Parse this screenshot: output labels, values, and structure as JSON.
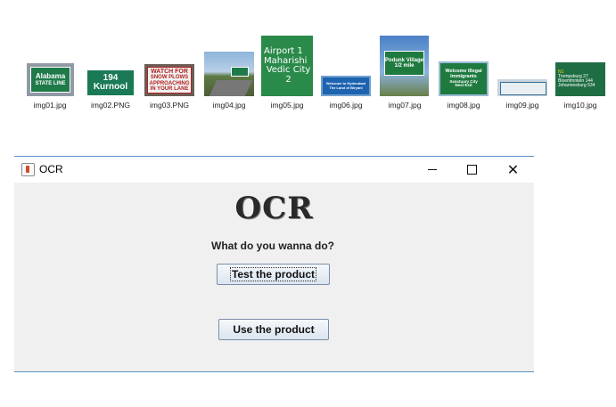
{
  "explorer": {
    "files": [
      {
        "name": "img01.jpg",
        "sign": [
          "Alabama",
          "STATE LINE"
        ]
      },
      {
        "name": "img02.PNG",
        "sign": [
          "194",
          "Kurnool"
        ]
      },
      {
        "name": "img03.PNG",
        "sign": [
          "WATCH FOR",
          "SNOW PLOWS",
          "APPROACHING",
          "IN YOUR LANE"
        ]
      },
      {
        "name": "img04.jpg",
        "sign": []
      },
      {
        "name": "img05.jpg",
        "sign": [
          "Airport  1",
          "Maharishi",
          "Vedic City 2"
        ]
      },
      {
        "name": "img06.jpg",
        "sign": [
          "Welcome to Hyderabad",
          "The Land of Biryani"
        ]
      },
      {
        "name": "img07.jpg",
        "sign": [
          "Podunk Village",
          "1/2 mile"
        ]
      },
      {
        "name": "img08.jpg",
        "sign": [
          "Welcome Illegal",
          "Immigrants",
          "Sanctuary City",
          "Next Exit"
        ]
      },
      {
        "name": "img09.jpg",
        "sign": []
      },
      {
        "name": "img10.jpg",
        "sign": [
          "N1",
          "Trompsburg   27",
          "Bloemfontein  144",
          "Johannesburg  534"
        ]
      }
    ]
  },
  "window": {
    "title": "OCR",
    "heading": "OCR",
    "question": "What do you wanna do?",
    "test_button": "Test the product",
    "use_button": "Use the product"
  },
  "colors": {
    "window_bg": "#f0f0f0",
    "accent_line": "#5a8fc4",
    "sign_green": "#1f6e43"
  }
}
